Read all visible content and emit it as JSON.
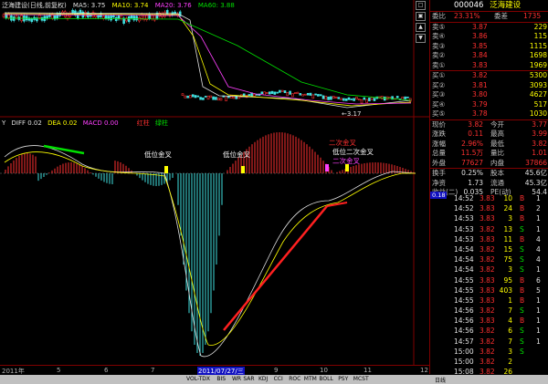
{
  "stock": {
    "code": "000046",
    "name": "泛海建设"
  },
  "indicators": {
    "ma_line": [
      {
        "label": "泛海建设(日线,前复权)",
        "color": "#e0e0e0"
      },
      {
        "label": "MA5: 3.75",
        "color": "#e0e0e0"
      },
      {
        "label": "MA10: 3.74",
        "color": "#ffff00"
      },
      {
        "label": "MA20: 3.76",
        "color": "#ff40ff"
      },
      {
        "label": "MA60: 3.88",
        "color": "#00e000"
      }
    ],
    "macd_line": [
      {
        "label": "DIFF 0.02",
        "color": "#e0e0e0"
      },
      {
        "label": "DEA 0.02",
        "color": "#ffff00"
      },
      {
        "label": "MACD 0.00",
        "color": "#ff40ff"
      },
      {
        "label": "红柱",
        "color": "#ff3030"
      },
      {
        "label": "绿柱",
        "color": "#00e000"
      }
    ]
  },
  "annotations": [
    {
      "text": "低位金叉",
      "color": "#ffffff"
    },
    {
      "text": "低位金叉",
      "color": "#ffffff"
    },
    {
      "text": "二次金叉",
      "color": "#ff3030"
    },
    {
      "text": "低位二次金叉",
      "color": "#ffffff"
    },
    {
      "text": "二次金叉",
      "color": "#ff40ff"
    }
  ],
  "price_labels": {
    "low": "←3.17"
  },
  "time_axis": {
    "left": "2011年",
    "labels": [
      "5",
      "6",
      "7",
      "9",
      "10",
      "11",
      "12"
    ],
    "cursor_date": "2011/07/27/三",
    "end": "日线"
  },
  "bottom_tabs": [
    "VOL-TDX",
    "BIS",
    "WR",
    "SAR",
    "KDJ",
    "CCI",
    "ROC",
    "MTM",
    "BOLL",
    "PSY",
    "MCST"
  ],
  "quote": {
    "weibi": {
      "label": "委比",
      "value": "23.31%",
      "label2": "委差",
      "value2": "1735"
    },
    "sells": [
      {
        "label": "卖⑤",
        "price": "3.87",
        "vol": "229"
      },
      {
        "label": "卖④",
        "price": "3.86",
        "vol": "115"
      },
      {
        "label": "卖③",
        "price": "3.85",
        "vol": "1115"
      },
      {
        "label": "卖②",
        "price": "3.84",
        "vol": "1698"
      },
      {
        "label": "卖①",
        "price": "3.83",
        "vol": "1969"
      }
    ],
    "buys": [
      {
        "label": "买①",
        "price": "3.82",
        "vol": "5300"
      },
      {
        "label": "买②",
        "price": "3.81",
        "vol": "3093"
      },
      {
        "label": "买③",
        "price": "3.80",
        "vol": "4627"
      },
      {
        "label": "买④",
        "price": "3.79",
        "vol": "517"
      },
      {
        "label": "买⑤",
        "price": "3.78",
        "vol": "1030"
      }
    ],
    "stats": [
      [
        "现价",
        "3.82",
        "今开",
        "3.77"
      ],
      [
        "涨跌",
        "0.11",
        "最高",
        "3.99"
      ],
      [
        "涨幅",
        "2.96%",
        "最低",
        "3.82"
      ],
      [
        "总量",
        "11.5万",
        "量比",
        "1.01"
      ],
      [
        "外盘",
        "77627",
        "内盘",
        "37866"
      ]
    ],
    "stats2": [
      [
        "换手",
        "0.25%",
        "股本",
        "45.6亿"
      ],
      [
        "净资",
        "1.73",
        "流通",
        "45.3亿"
      ],
      [
        "收益(二)",
        "0.035",
        "PE(动)",
        "54.4"
      ]
    ],
    "tag": "0.18",
    "ticks": [
      [
        "14:52",
        "3.83",
        "10",
        "B",
        "1"
      ],
      [
        "14:52",
        "3.83",
        "24",
        "B",
        "2"
      ],
      [
        "14:53",
        "3.83",
        "3",
        "B",
        "1"
      ],
      [
        "14:53",
        "3.82",
        "13",
        "S",
        "1"
      ],
      [
        "14:53",
        "3.83",
        "11",
        "B",
        "4"
      ],
      [
        "14:54",
        "3.82",
        "15",
        "S",
        "4"
      ],
      [
        "14:54",
        "3.82",
        "75",
        "S",
        "4"
      ],
      [
        "14:54",
        "3.82",
        "3",
        "S",
        "1"
      ],
      [
        "14:55",
        "3.83",
        "95",
        "B",
        "6"
      ],
      [
        "14:55",
        "3.83",
        "403",
        "B",
        "5"
      ],
      [
        "14:55",
        "3.83",
        "1",
        "B",
        "1"
      ],
      [
        "14:56",
        "3.82",
        "7",
        "S",
        "1"
      ],
      [
        "14:56",
        "3.83",
        "4",
        "B",
        "1"
      ],
      [
        "14:56",
        "3.82",
        "6",
        "S",
        "1"
      ],
      [
        "14:57",
        "3.82",
        "7",
        "S",
        "1"
      ],
      [
        "15:00",
        "3.82",
        "3",
        "S",
        ""
      ],
      [
        "15:00",
        "3.82",
        "2",
        "",
        ""
      ],
      [
        "15:08",
        "3.82",
        "26",
        "",
        ""
      ]
    ]
  }
}
